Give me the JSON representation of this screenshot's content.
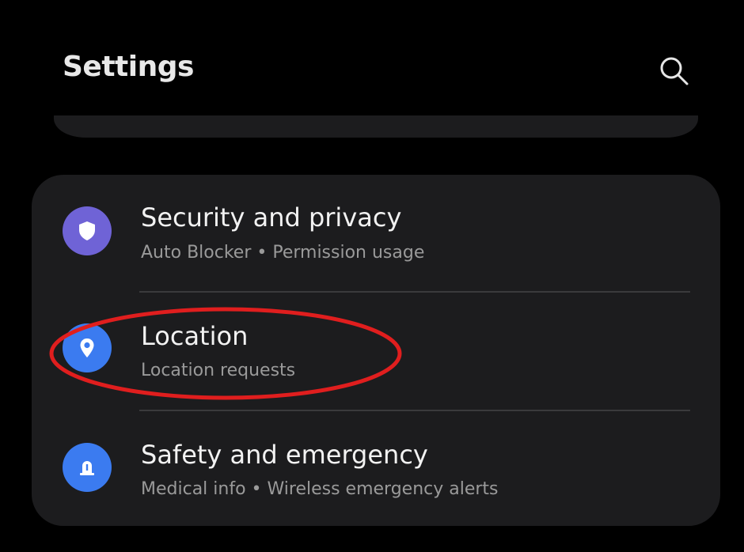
{
  "header": {
    "title": "Settings",
    "search_icon": "search-icon"
  },
  "settings_group": {
    "items": [
      {
        "title": "Security and privacy",
        "subtitle": "Auto Blocker • Permission usage",
        "icon": "shield-icon",
        "icon_color": "#6f63d6"
      },
      {
        "title": "Location",
        "subtitle": "Location requests",
        "icon": "location-pin-icon",
        "icon_color": "#3b7bf0"
      },
      {
        "title": "Safety and emergency",
        "subtitle": "Medical info • Wireless emergency alerts",
        "icon": "emergency-beacon-icon",
        "icon_color": "#3b7bf0"
      }
    ]
  },
  "annotation": {
    "target": "Location",
    "color": "#e01e1e"
  }
}
